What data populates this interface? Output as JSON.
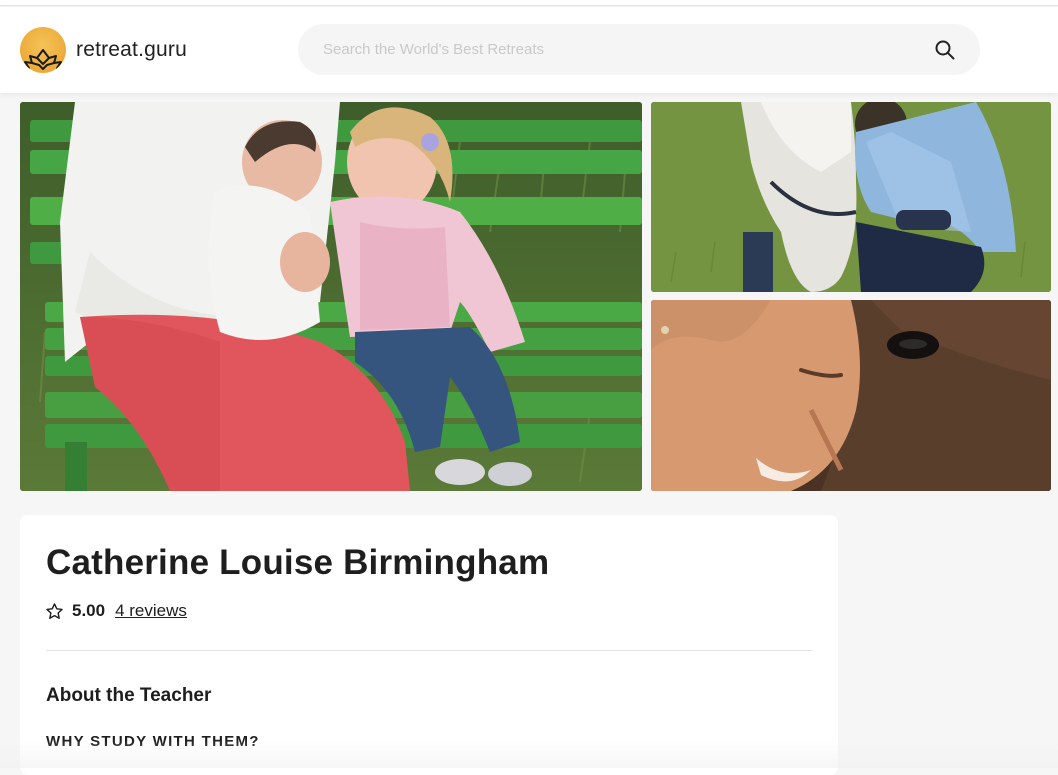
{
  "header": {
    "logo_text": "retreat.guru",
    "logo_icon": "lotus-sun-icon",
    "search_placeholder": "Search the World's Best Retreats",
    "search_value": "",
    "search_icon": "search-icon",
    "colors": {
      "logo_sun": "#eeb03e",
      "search_bg": "#f5f5f5"
    }
  },
  "gallery": {
    "photos": [
      {
        "name": "photo-mother-baby-child-bench"
      },
      {
        "name": "photo-horse-and-rider"
      },
      {
        "name": "photo-woman-and-horse-closeup"
      }
    ]
  },
  "teacher": {
    "name": "Catherine Louise Birmingham",
    "rating": "5.00",
    "reviews_label": "4 reviews",
    "star_icon": "star-outline-icon",
    "section_title": "About the Teacher",
    "section_subtitle": "WHY STUDY WITH THEM?"
  }
}
